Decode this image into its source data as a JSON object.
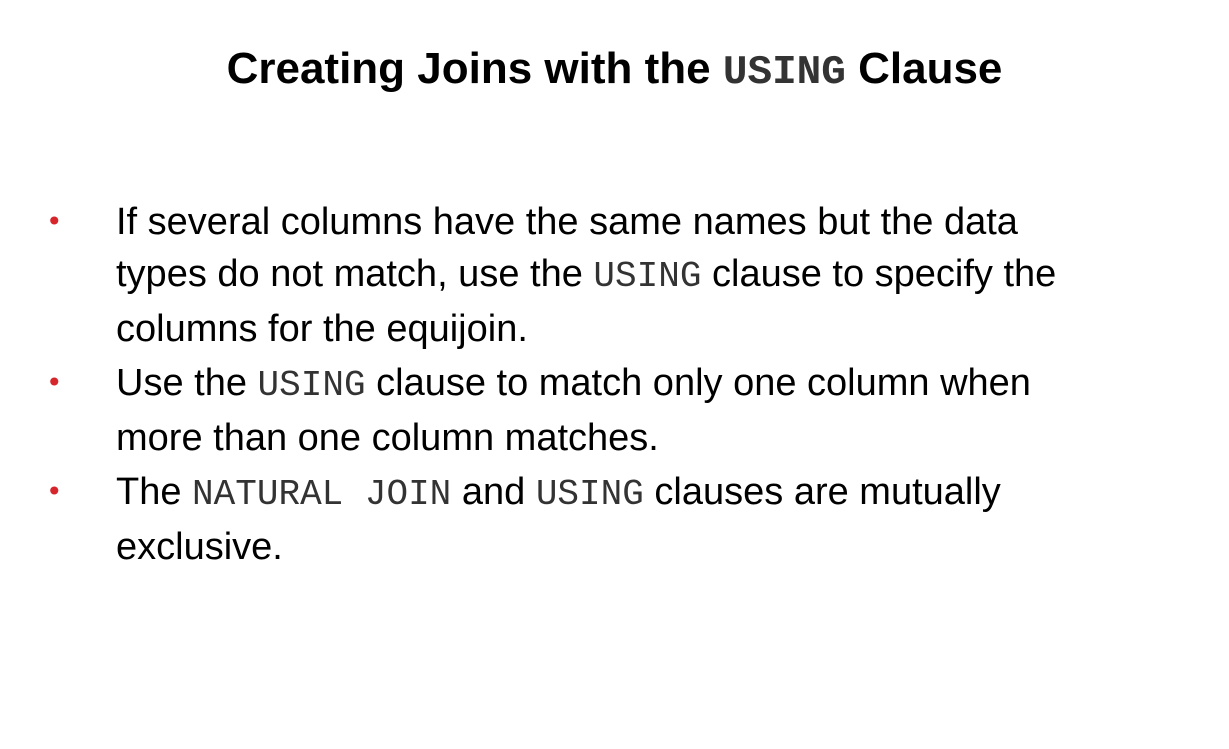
{
  "title": {
    "prefix": "Creating Joins with the ",
    "code": "USING",
    "suffix": " Clause"
  },
  "bullets": [
    {
      "lines": [
        [
          {
            "t": "If several columns have the same names but the data"
          }
        ],
        [
          {
            "t": "types do not match, use the "
          },
          {
            "c": "USING"
          },
          {
            "t": " clause to specify the"
          }
        ],
        [
          {
            "t": "columns for the equijoin."
          }
        ]
      ]
    },
    {
      "lines": [
        [
          {
            "t": "Use the "
          },
          {
            "c": "USING"
          },
          {
            "t": " clause to match only one column when"
          }
        ],
        [
          {
            "t": "more than one column matches."
          }
        ]
      ]
    },
    {
      "lines": [
        [
          {
            "t": "The "
          },
          {
            "c": "NATURAL JOIN"
          },
          {
            "t": " and "
          },
          {
            "c": "USING"
          },
          {
            "t": " clauses are mutually"
          }
        ],
        [
          {
            "t": "exclusive."
          }
        ]
      ]
    }
  ],
  "bullet_glyph": "•",
  "colors": {
    "bullet": "#d6252b",
    "text": "#000000",
    "code": "#333333",
    "background": "#ffffff"
  }
}
